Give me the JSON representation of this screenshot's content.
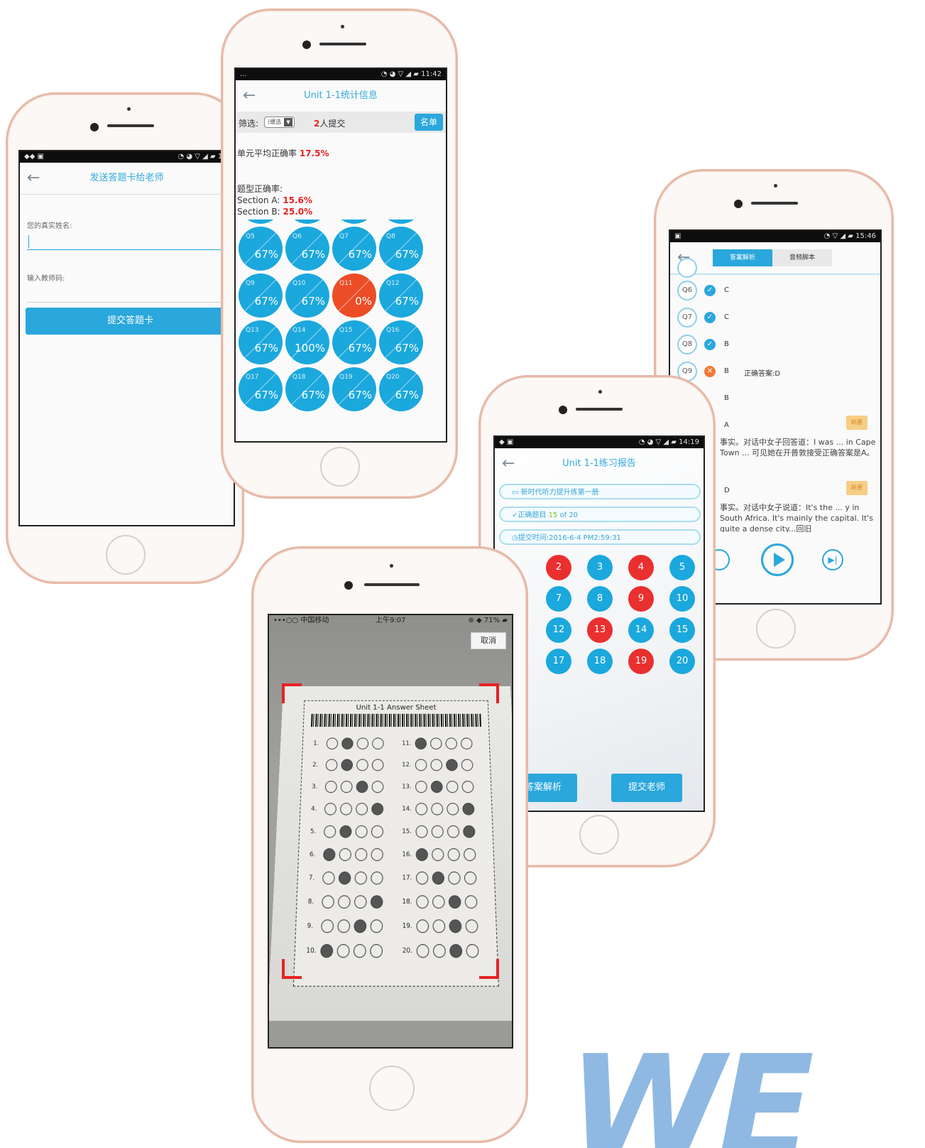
{
  "phone_send": {
    "status_right": "15:",
    "title": "发送答题卡给老师",
    "name_label": "您的真实姓名:",
    "teacher_label": "输入教师码:",
    "submit": "提交答题卡"
  },
  "phone_stats": {
    "status_left": "...",
    "status_time": "11:42",
    "title": "Unit 1-1统计信息",
    "filter_label": "筛选:",
    "filter_value": "(缓选",
    "submit_count": "2",
    "submit_suffix": "人提交",
    "roster_btn": "名单",
    "avg_label": "单元平均正确率",
    "avg_value": "17.5%",
    "type_label": "题型正确率:",
    "section_a_label": "Section A:",
    "section_a_value": "15.6%",
    "section_b_label": "Section B:",
    "section_b_value": "25.0%",
    "circles": [
      {
        "q": "Q5",
        "p": "67%",
        "bad": false
      },
      {
        "q": "Q6",
        "p": "67%",
        "bad": false
      },
      {
        "q": "Q7",
        "p": "67%",
        "bad": false
      },
      {
        "q": "Q8",
        "p": "67%",
        "bad": false
      },
      {
        "q": "Q9",
        "p": "67%",
        "bad": false
      },
      {
        "q": "Q10",
        "p": "67%",
        "bad": false
      },
      {
        "q": "Q11",
        "p": "0%",
        "bad": true
      },
      {
        "q": "Q12",
        "p": "67%",
        "bad": false
      },
      {
        "q": "Q13",
        "p": "67%",
        "bad": false
      },
      {
        "q": "Q14",
        "p": "100%",
        "bad": false
      },
      {
        "q": "Q15",
        "p": "67%",
        "bad": false
      },
      {
        "q": "Q16",
        "p": "67%",
        "bad": false
      },
      {
        "q": "Q17",
        "p": "67%",
        "bad": false
      },
      {
        "q": "Q18",
        "p": "67%",
        "bad": false
      },
      {
        "q": "Q19",
        "p": "67%",
        "bad": false
      },
      {
        "q": "Q20",
        "p": "67%",
        "bad": false
      }
    ]
  },
  "phone_analysis": {
    "status_time": "15:46",
    "tab_active": "答案解析",
    "tab_other": "音频脚本",
    "rows": [
      {
        "q": "Q6",
        "ok": true,
        "ans": "C",
        "correct": ""
      },
      {
        "q": "Q7",
        "ok": true,
        "ans": "C",
        "correct": ""
      },
      {
        "q": "Q8",
        "ok": true,
        "ans": "B",
        "correct": ""
      },
      {
        "q": "Q9",
        "ok": false,
        "ans": "B",
        "correct": "正确答案:D"
      }
    ],
    "row_b": "B",
    "row_a": "A",
    "explain1": "事实。对话中女子回答道：I was ... in Cape Town ... 可见她在开普敦接受正确答案是A。",
    "row_d": "D",
    "explain2": "事实。对话中女子说道：It's the ... y in South Africa. It's mainly the capital. It's quite a dense city...回旧",
    "badge": "听原"
  },
  "phone_report": {
    "status_time": "14:19",
    "title": "Unit 1-1练习报告",
    "book": "新时代听力提升练第一册",
    "correct_prefix": "正确题目",
    "correct_num": "15",
    "correct_suffix": "of 20",
    "time": "提交时间:2016-6-4 PM2:59:31",
    "nums": [
      {
        "n": "2",
        "red": true
      },
      {
        "n": "3",
        "red": false
      },
      {
        "n": "4",
        "red": true
      },
      {
        "n": "5",
        "red": false
      },
      {
        "n": "7",
        "red": false
      },
      {
        "n": "8",
        "red": false
      },
      {
        "n": "9",
        "red": true
      },
      {
        "n": "10",
        "red": false
      },
      {
        "n": "12",
        "red": false
      },
      {
        "n": "13",
        "red": true
      },
      {
        "n": "14",
        "red": false
      },
      {
        "n": "15",
        "red": false
      },
      {
        "n": "17",
        "red": false
      },
      {
        "n": "18",
        "red": false
      },
      {
        "n": "19",
        "red": true
      },
      {
        "n": "20",
        "red": false
      }
    ],
    "btn_analysis": "答案解析",
    "btn_submit": "提交老师"
  },
  "phone_scan": {
    "status_left": "•••○○ 中国移动",
    "status_time": "上午9:07",
    "status_right": "71%",
    "cancel": "取消",
    "sheet_title": "Unit 1-1   Answer Sheet",
    "left_rows": [
      {
        "n": "1.",
        "f": 1
      },
      {
        "n": "2.",
        "f": 1
      },
      {
        "n": "3.",
        "f": 2
      },
      {
        "n": "4.",
        "f": 3
      },
      {
        "n": "5.",
        "f": 1
      },
      {
        "n": "6.",
        "f": 0
      },
      {
        "n": "7.",
        "f": 1
      },
      {
        "n": "8.",
        "f": 3
      },
      {
        "n": "9.",
        "f": 2
      },
      {
        "n": "10.",
        "f": 0
      }
    ],
    "right_rows": [
      {
        "n": "11.",
        "f": 0
      },
      {
        "n": "12.",
        "f": 2
      },
      {
        "n": "13.",
        "f": 1
      },
      {
        "n": "14.",
        "f": 3
      },
      {
        "n": "15.",
        "f": 3
      },
      {
        "n": "16.",
        "f": 0
      },
      {
        "n": "17.",
        "f": 1
      },
      {
        "n": "18.",
        "f": 2
      },
      {
        "n": "19.",
        "f": 2
      },
      {
        "n": "20.",
        "f": 2
      }
    ]
  },
  "brand": {
    "mark": "WE",
    "color": "#8fb9e2"
  },
  "colors": {
    "accent": "#1ba8dd",
    "wrong": "#ec4d26",
    "frame": "#e6b9a6"
  }
}
